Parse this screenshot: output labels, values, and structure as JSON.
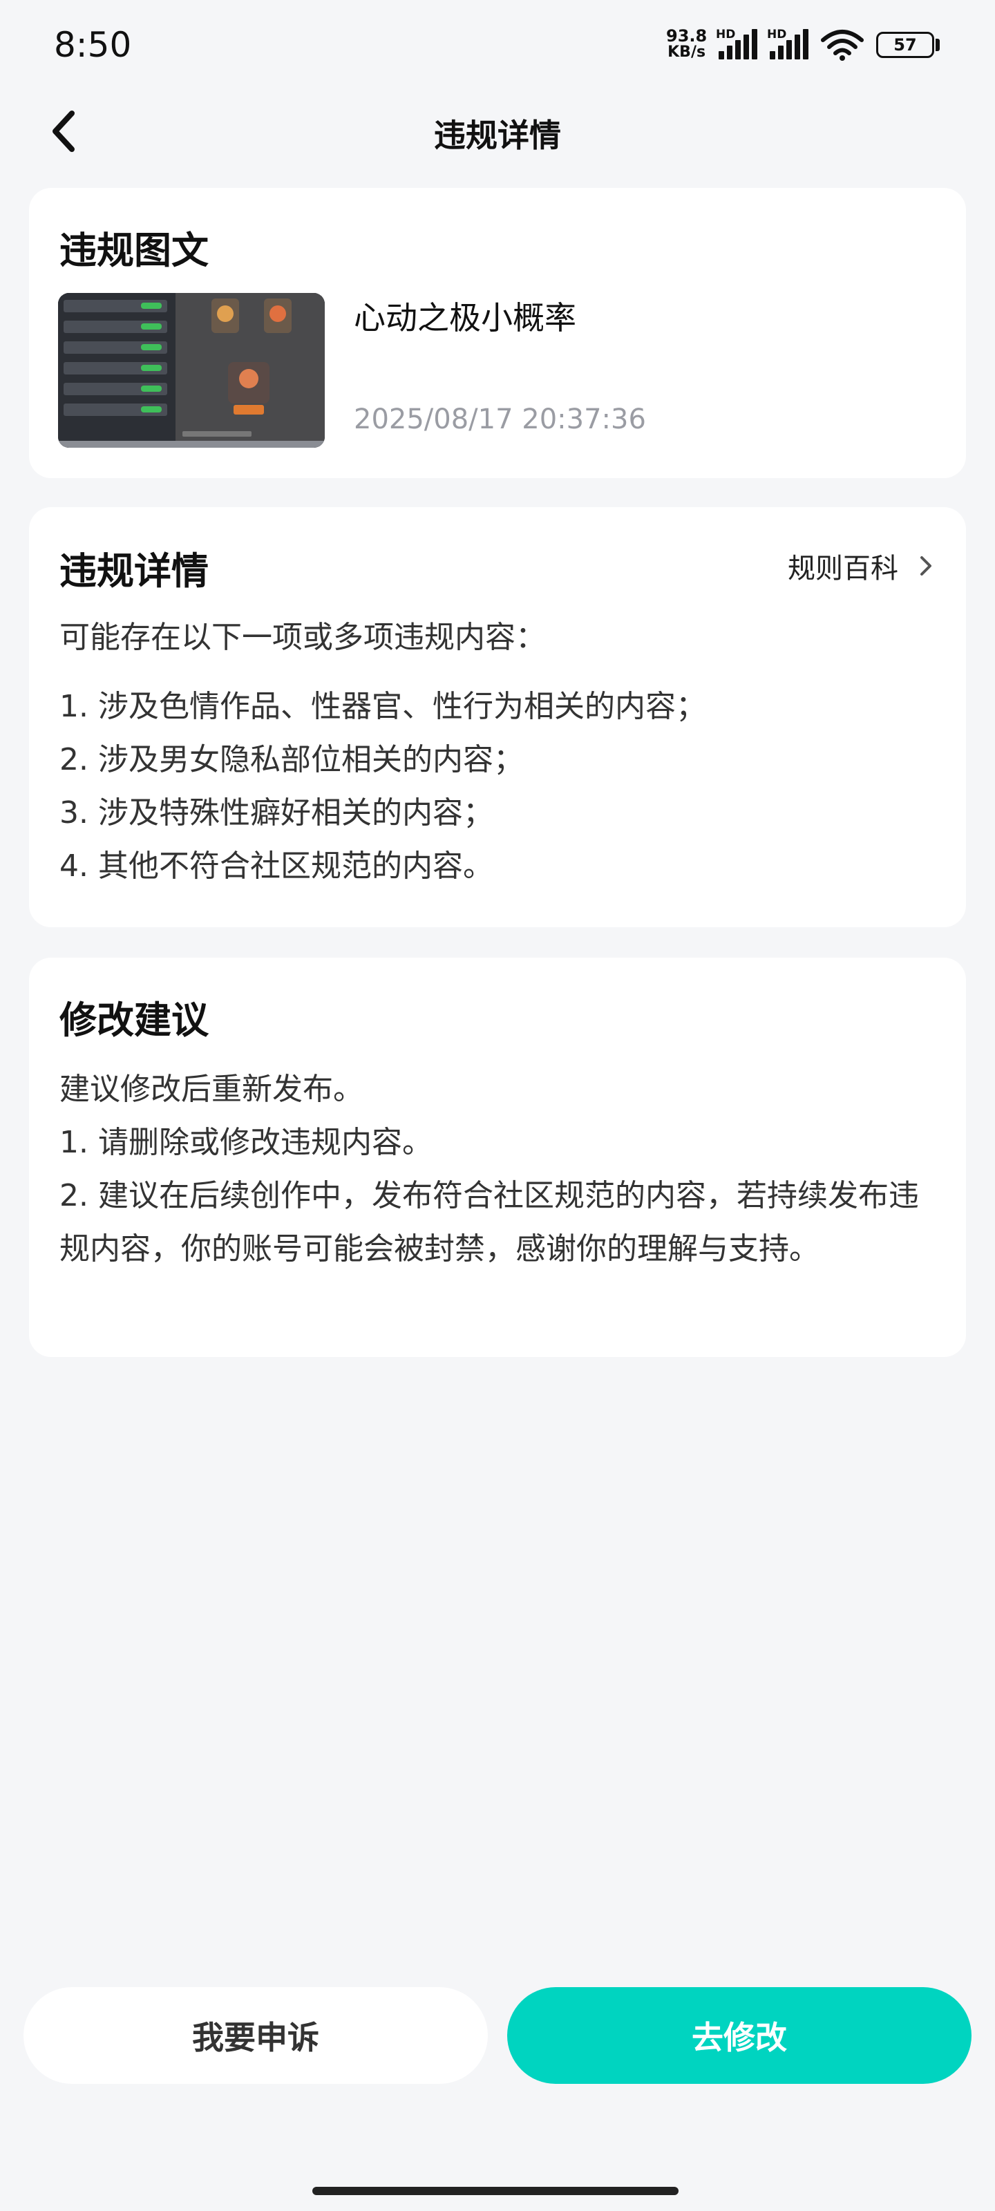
{
  "status_bar": {
    "time": "8:50",
    "net_speed_value": "93.8",
    "net_speed_unit": "KB/s",
    "sim1_label": "HD",
    "sim2_label": "HD",
    "battery": "57",
    "icons": [
      "signal-icon",
      "wifi-icon",
      "battery-icon"
    ]
  },
  "nav": {
    "title": "违规详情",
    "back_icon": "chevron-left-icon"
  },
  "post_card": {
    "title": "违规图文",
    "post_title": "心动之极小概率",
    "post_time": "2025/08/17 20:37:36"
  },
  "detail_card": {
    "title": "违规详情",
    "rules_link": "规则百科",
    "intro": "可能存在以下一项或多项违规内容：",
    "items": [
      "1. 涉及色情作品、性器官、性行为相关的内容；",
      "2. 涉及男女隐私部位相关的内容；",
      "3. 涉及特殊性癖好相关的内容；",
      "4. 其他不符合社区规范的内容。"
    ]
  },
  "advice_card": {
    "title": "修改建议",
    "lines": [
      "建议修改后重新发布。",
      "1. 请删除或修改违规内容。",
      "2. 建议在后续创作中，发布符合社区规范的内容，若持续发布违规内容，你的账号可能会被封禁，感谢你的理解与支持。"
    ]
  },
  "buttons": {
    "appeal": "我要申诉",
    "edit": "去修改"
  },
  "colors": {
    "accent": "#00d4c0",
    "background": "#f5f6f8",
    "muted_text": "#9a9ca3"
  }
}
